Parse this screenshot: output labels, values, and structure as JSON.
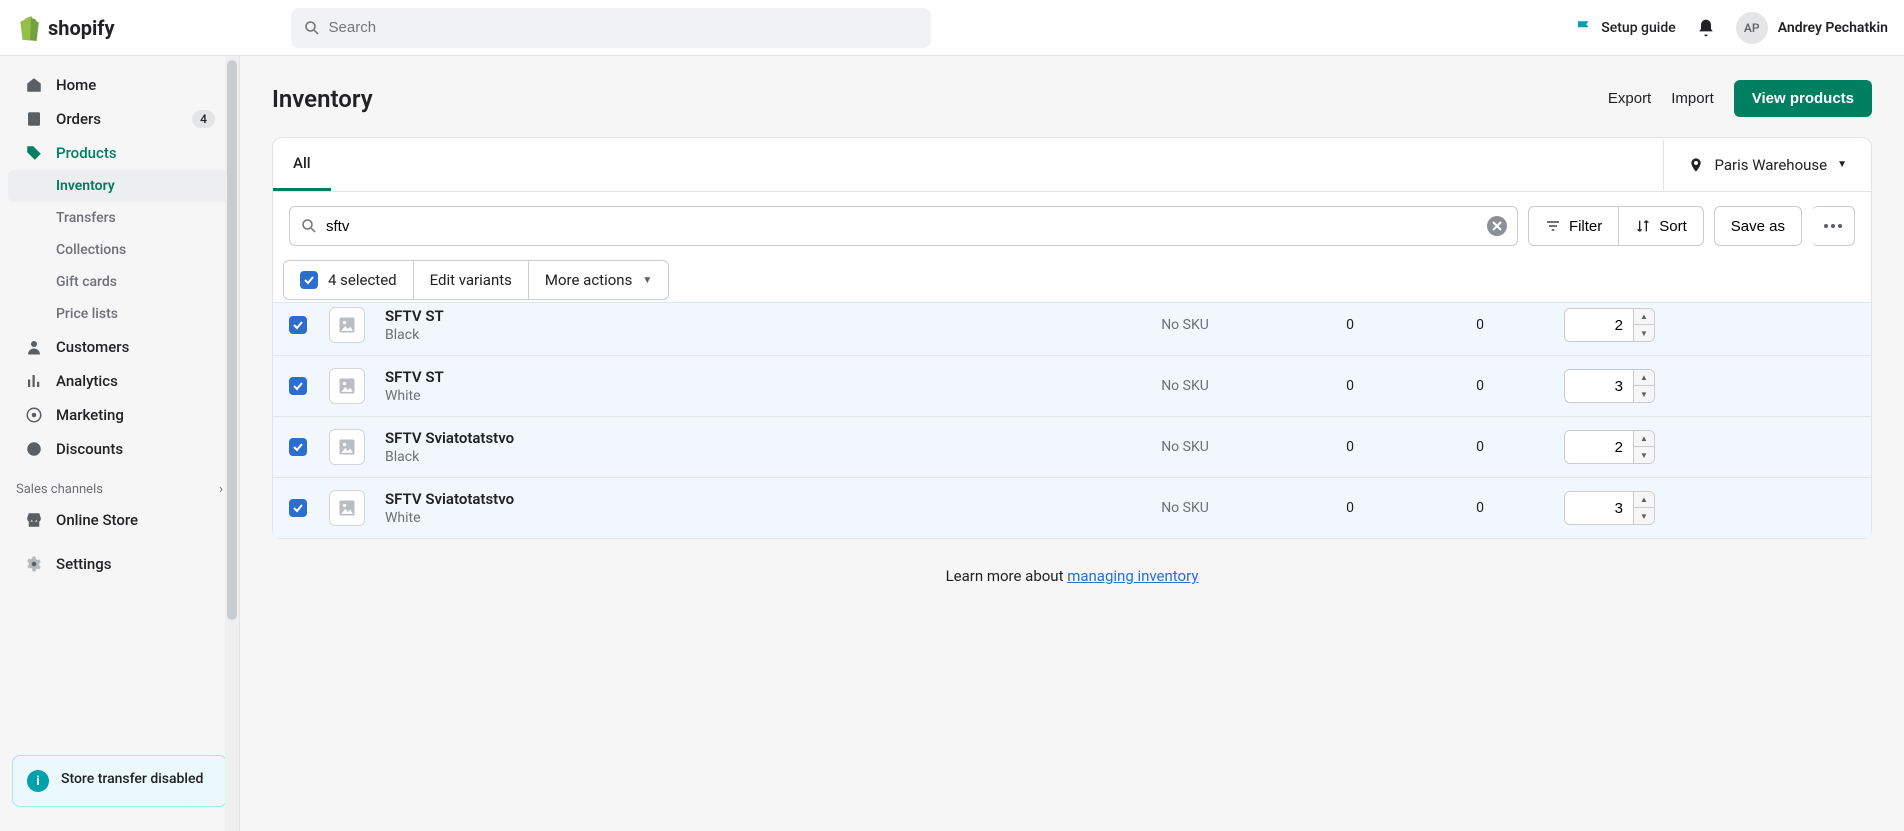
{
  "topbar": {
    "search_placeholder": "Search",
    "setup_guide": "Setup guide",
    "avatar_initials": "AP",
    "user_name": "Andrey Pechatkin"
  },
  "sidebar": {
    "items": [
      {
        "label": "Home",
        "icon": "home"
      },
      {
        "label": "Orders",
        "icon": "orders",
        "badge": "4"
      },
      {
        "label": "Products",
        "icon": "tag",
        "active": true,
        "sub": [
          {
            "label": "Inventory",
            "active": true
          },
          {
            "label": "Transfers"
          },
          {
            "label": "Collections"
          },
          {
            "label": "Gift cards"
          },
          {
            "label": "Price lists"
          }
        ]
      },
      {
        "label": "Customers",
        "icon": "user"
      },
      {
        "label": "Analytics",
        "icon": "analytics"
      },
      {
        "label": "Marketing",
        "icon": "target"
      },
      {
        "label": "Discounts",
        "icon": "discount"
      }
    ],
    "sales_channels_label": "Sales channels",
    "online_store": "Online Store",
    "settings": "Settings",
    "alert": "Store transfer disabled"
  },
  "page": {
    "title": "Inventory",
    "export": "Export",
    "import": "Import",
    "view_products": "View products"
  },
  "tabs": {
    "all": "All"
  },
  "location": "Paris Warehouse",
  "search": {
    "value": "sftv"
  },
  "toolbar": {
    "filter": "Filter",
    "sort": "Sort",
    "save_as": "Save as"
  },
  "bulk": {
    "selected_text": "4 selected",
    "edit_variants": "Edit variants",
    "more_actions": "More actions"
  },
  "columns": {
    "no_sku": "No SKU"
  },
  "rows": [
    {
      "title": "SFTV ST",
      "variant": "Black",
      "sku": "No SKU",
      "c1": "0",
      "c2": "0",
      "qty": "2",
      "truncated": true
    },
    {
      "title": "SFTV ST",
      "variant": "White",
      "sku": "No SKU",
      "c1": "0",
      "c2": "0",
      "qty": "3"
    },
    {
      "title": "SFTV Sviatotatstvo",
      "variant": "Black",
      "sku": "No SKU",
      "c1": "0",
      "c2": "0",
      "qty": "2"
    },
    {
      "title": "SFTV Sviatotatstvo",
      "variant": "White",
      "sku": "No SKU",
      "c1": "0",
      "c2": "0",
      "qty": "3"
    }
  ],
  "footer": {
    "learn_prefix": "Learn more about ",
    "learn_link": "managing inventory"
  }
}
